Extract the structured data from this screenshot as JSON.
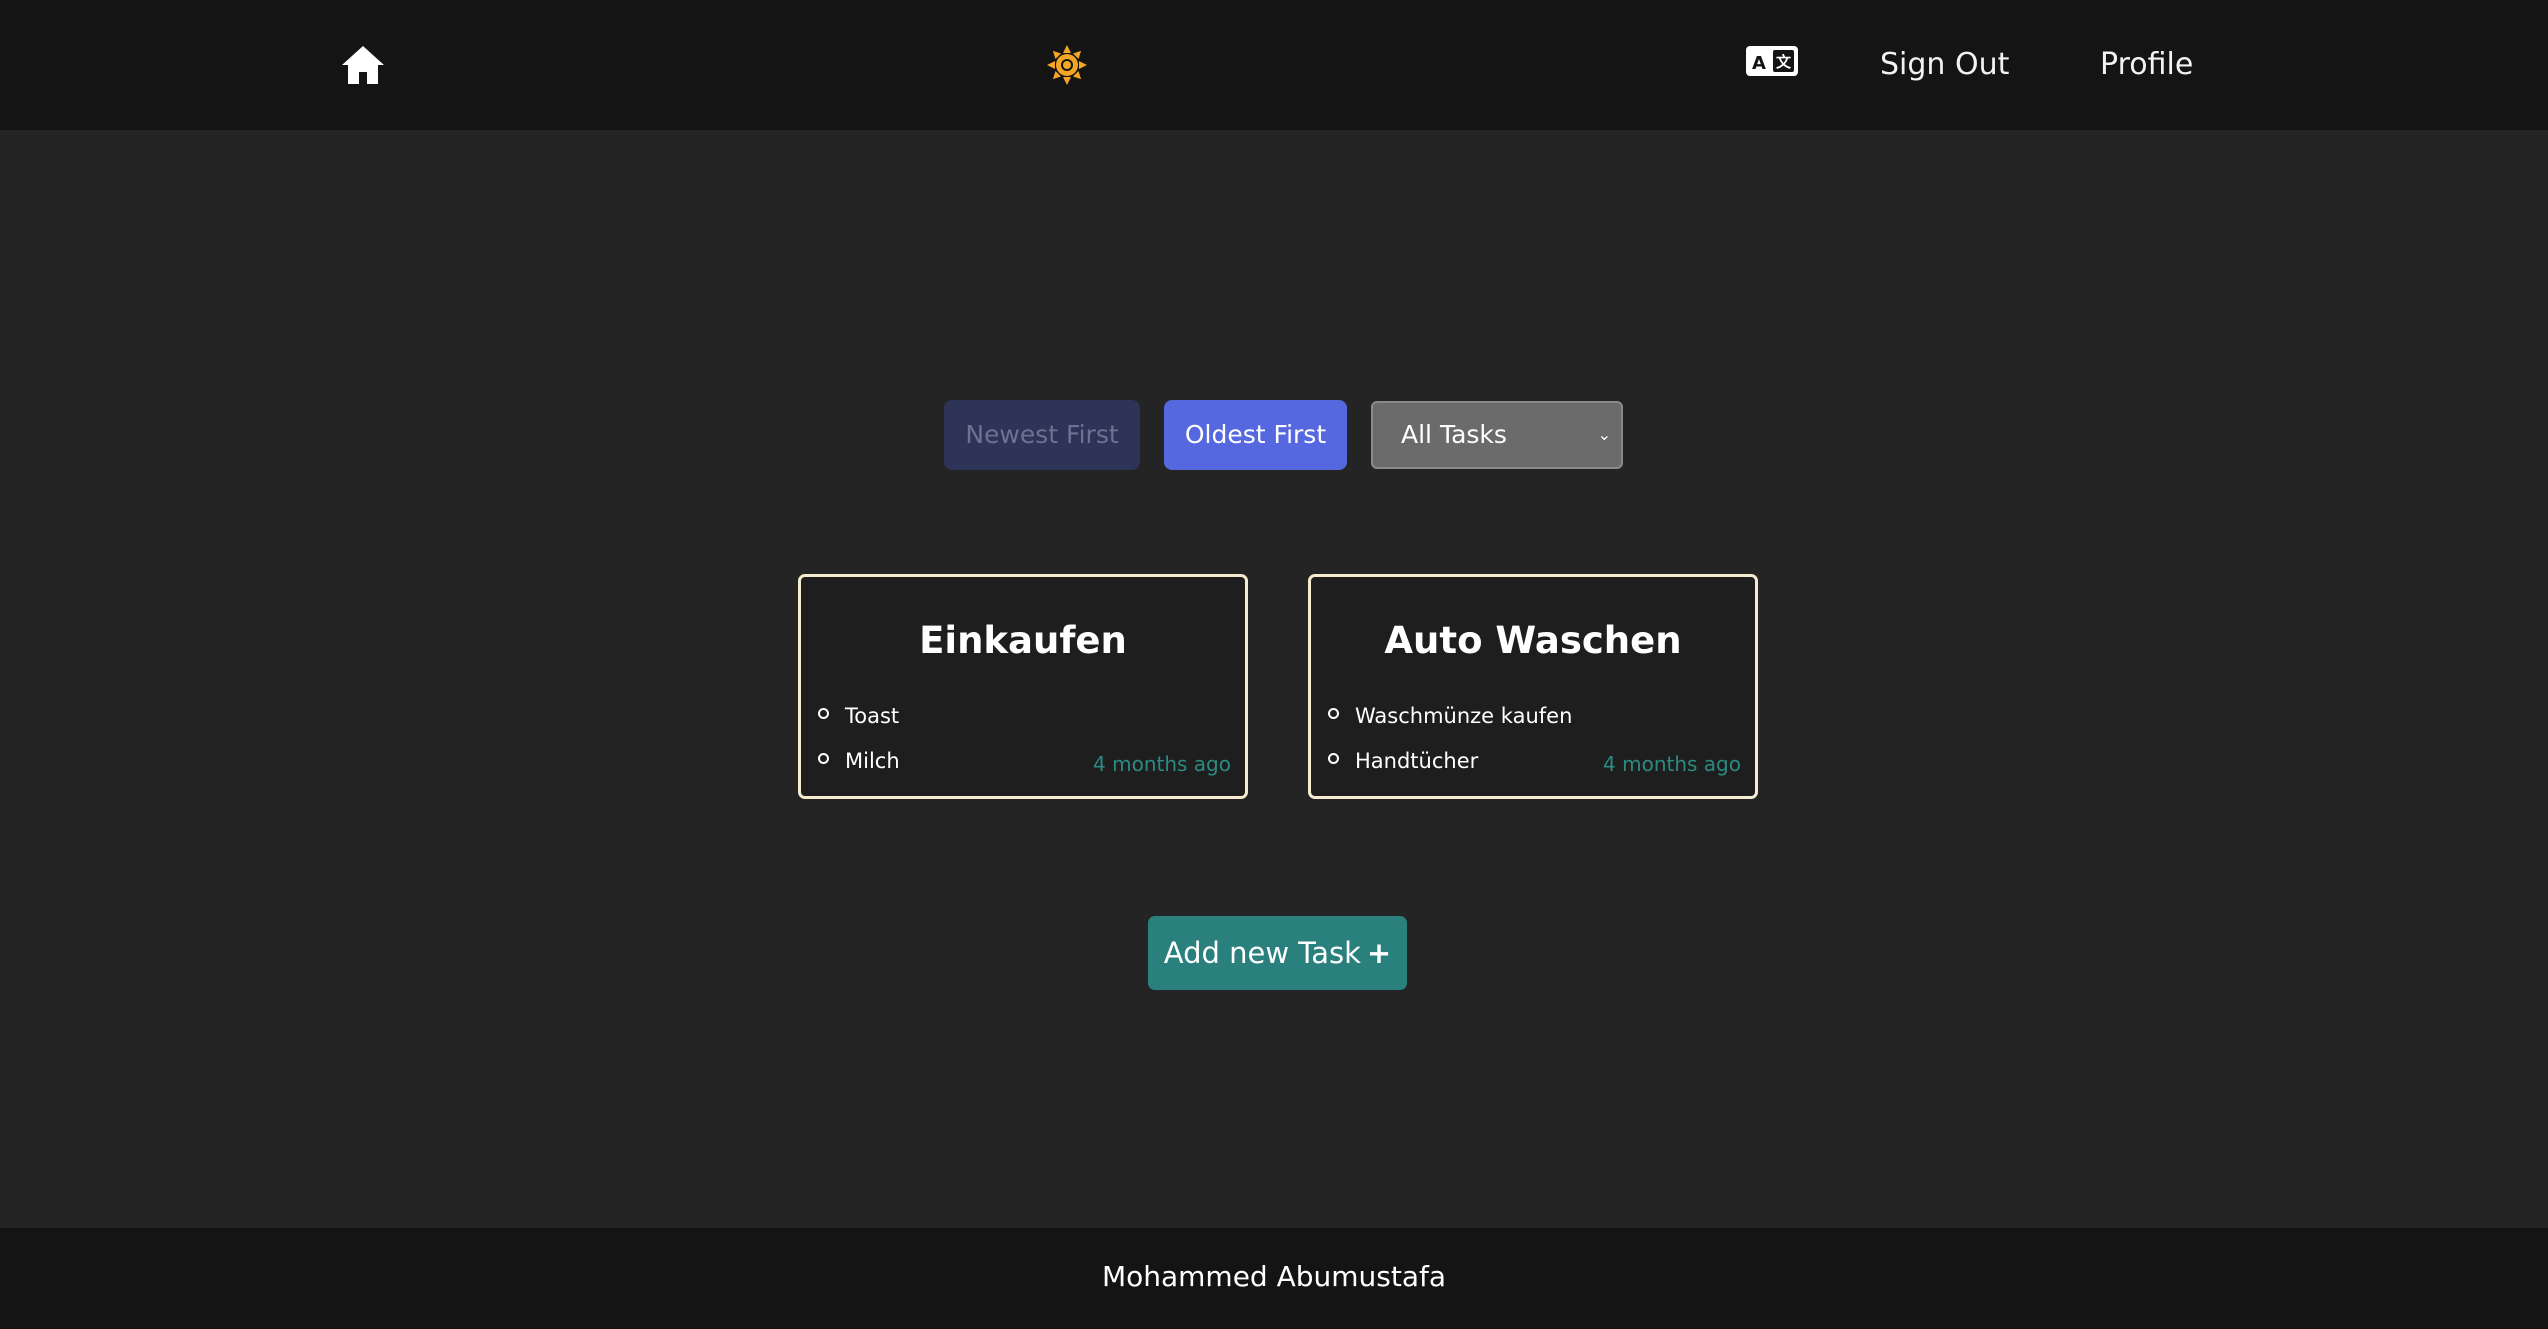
{
  "navbar": {
    "home_icon": "home-icon",
    "theme_icon": "sun-icon",
    "theme_color": "#f5a524",
    "language_icon": "translate-icon",
    "sign_out_label": "Sign Out",
    "profile_label": "Profile"
  },
  "controls": {
    "newest_label": "Newest First",
    "oldest_label": "Oldest First",
    "filter_selected": "All Tasks",
    "active_sort": "Oldest First"
  },
  "tasks": [
    {
      "title": "Einkaufen",
      "items": [
        "Toast",
        "Milch"
      ],
      "time": "4 months ago"
    },
    {
      "title": "Auto Waschen",
      "items": [
        "Waschmünze kaufen",
        "Handtücher"
      ],
      "time": "4 months ago"
    }
  ],
  "add_button": {
    "label": "Add new Task",
    "icon": "plus-icon"
  },
  "footer": {
    "author": "Mohammed Abumustafa"
  },
  "colors": {
    "background": "#242424",
    "navbar": "#141414",
    "accent_blue": "#5568e0",
    "accent_teal": "#29807c",
    "card_border": "#f5ecd0"
  }
}
